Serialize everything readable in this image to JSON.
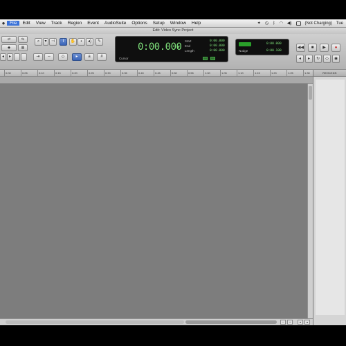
{
  "menubar": {
    "items": [
      "File",
      "Edit",
      "View",
      "Track",
      "Region",
      "Event",
      "AudioSuite",
      "Options",
      "Setup",
      "Window",
      "Help"
    ],
    "active_index": 0,
    "battery_text": "(Not Charging)"
  },
  "window": {
    "title": "Edit: Video Sync Project"
  },
  "counter": {
    "main": "0:00.000",
    "start_label": "Start",
    "start_value": "0:00.000",
    "end_label": "End",
    "end_value": "0:00.000",
    "length_label": "Length",
    "length_value": "0:00.000",
    "cursor_label": "Cursor"
  },
  "subcounter": {
    "row1_value": "0:00.000",
    "nudge_label": "Nudge",
    "nudge_value": "0:00.100"
  },
  "ruler": {
    "ticks": [
      "0:00",
      "0:05",
      "0:10",
      "0:15",
      "0:20",
      "0:25",
      "0:30",
      "0:35",
      "0:40",
      "0:45",
      "0:50",
      "0:55",
      "1:00",
      "1:05",
      "1:10",
      "1:15",
      "1:20",
      "1:25",
      "1:30",
      "1:35"
    ]
  },
  "regions": {
    "title": "REGIONS"
  },
  "icons": {
    "mode_shuffle": "shuffle-icon",
    "zoom": "zoomer-icon",
    "trim": "trim-icon",
    "selector": "selector-icon",
    "grabber": "grabber-icon",
    "scrubber": "scrubber-icon",
    "pencil": "pencil-icon"
  }
}
